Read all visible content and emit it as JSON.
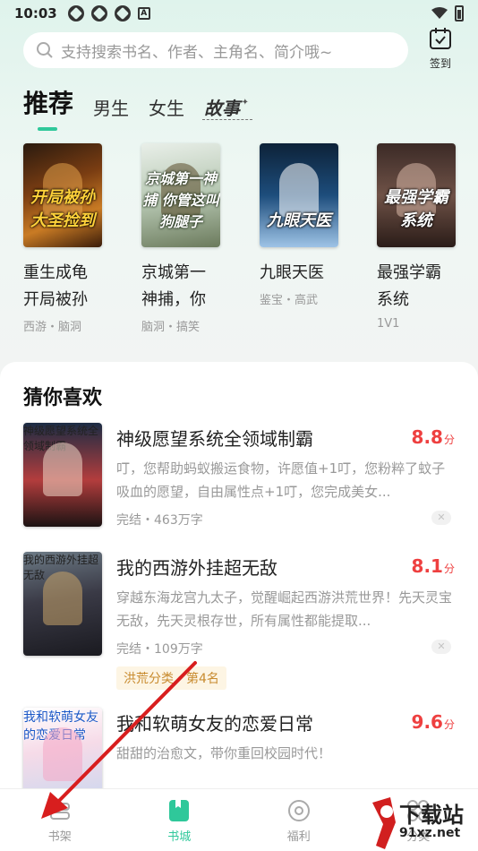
{
  "status_bar": {
    "time": "10:03",
    "notification_icons": [
      "app-icon",
      "app-icon",
      "app-icon"
    ],
    "a_icon": "A"
  },
  "search": {
    "placeholder": "支持搜索书名、作者、主角名、简介哦~"
  },
  "checkin": {
    "label": "签到"
  },
  "tabs": [
    {
      "label": "推荐",
      "active": true
    },
    {
      "label": "男生",
      "active": false
    },
    {
      "label": "女生",
      "active": false
    },
    {
      "label": "故事",
      "active": false
    }
  ],
  "recommend": [
    {
      "title_line1": "重生成龟",
      "title_line2": "开局被孙",
      "tags": "西游・脑洞",
      "cover_text": "开局被孙大圣捡到"
    },
    {
      "title_line1": "京城第一",
      "title_line2": "神捕，你",
      "tags": "脑洞・搞笑",
      "cover_text": "京城第一神捕 你管这叫狗腿子"
    },
    {
      "title_line1": "九眼天医",
      "title_line2": "",
      "tags": "鉴宝・高武",
      "cover_text": "九眼天医"
    },
    {
      "title_line1": "最强学霸",
      "title_line2": "系统",
      "tags": "1V1",
      "cover_text": "最强学霸系统"
    }
  ],
  "guess": {
    "section_title": "猜你喜欢",
    "books": [
      {
        "title": "神级愿望系统全领域制霸",
        "score": "8.8",
        "score_unit": "分",
        "desc": "叮，您帮助蚂蚁搬运食物，许愿值+1叮，您粉粹了蚊子吸血的愿望，自由属性点+1叮，您完成美女...",
        "meta": "完结・463万字",
        "cover_text": "神级愿望系统全领域制霸"
      },
      {
        "title": "我的西游外挂超无敌",
        "score": "8.1",
        "score_unit": "分",
        "desc": "穿越东海龙宫九太子，觉醒崛起西游洪荒世界！先天灵宝无敌，先天灵根存世，所有属性都能提取...",
        "meta": "完结・109万字",
        "rank_tag": "洪荒分类・第4名",
        "cover_text": "我的西游外挂超无敌"
      },
      {
        "title": "我和软萌女友的恋爱日常",
        "score": "9.6",
        "score_unit": "分",
        "desc": "甜甜的治愈文，带你重回校园时代！",
        "cover_text": "我和软萌女友的恋爱日常"
      }
    ]
  },
  "bottom_nav": [
    {
      "label": "书架",
      "icon": "bookshelf-icon",
      "active": false
    },
    {
      "label": "书城",
      "icon": "bookstore-icon",
      "active": true
    },
    {
      "label": "福利",
      "icon": "welfare-icon",
      "active": false
    },
    {
      "label": "分类",
      "icon": "category-icon",
      "active": false
    }
  ],
  "watermark": {
    "text": "下载站",
    "url": "91xz.net",
    "logo": "9"
  },
  "colors": {
    "accent": "#2fc89a",
    "score": "#ee4040",
    "annotation_arrow": "#d81e1e"
  }
}
